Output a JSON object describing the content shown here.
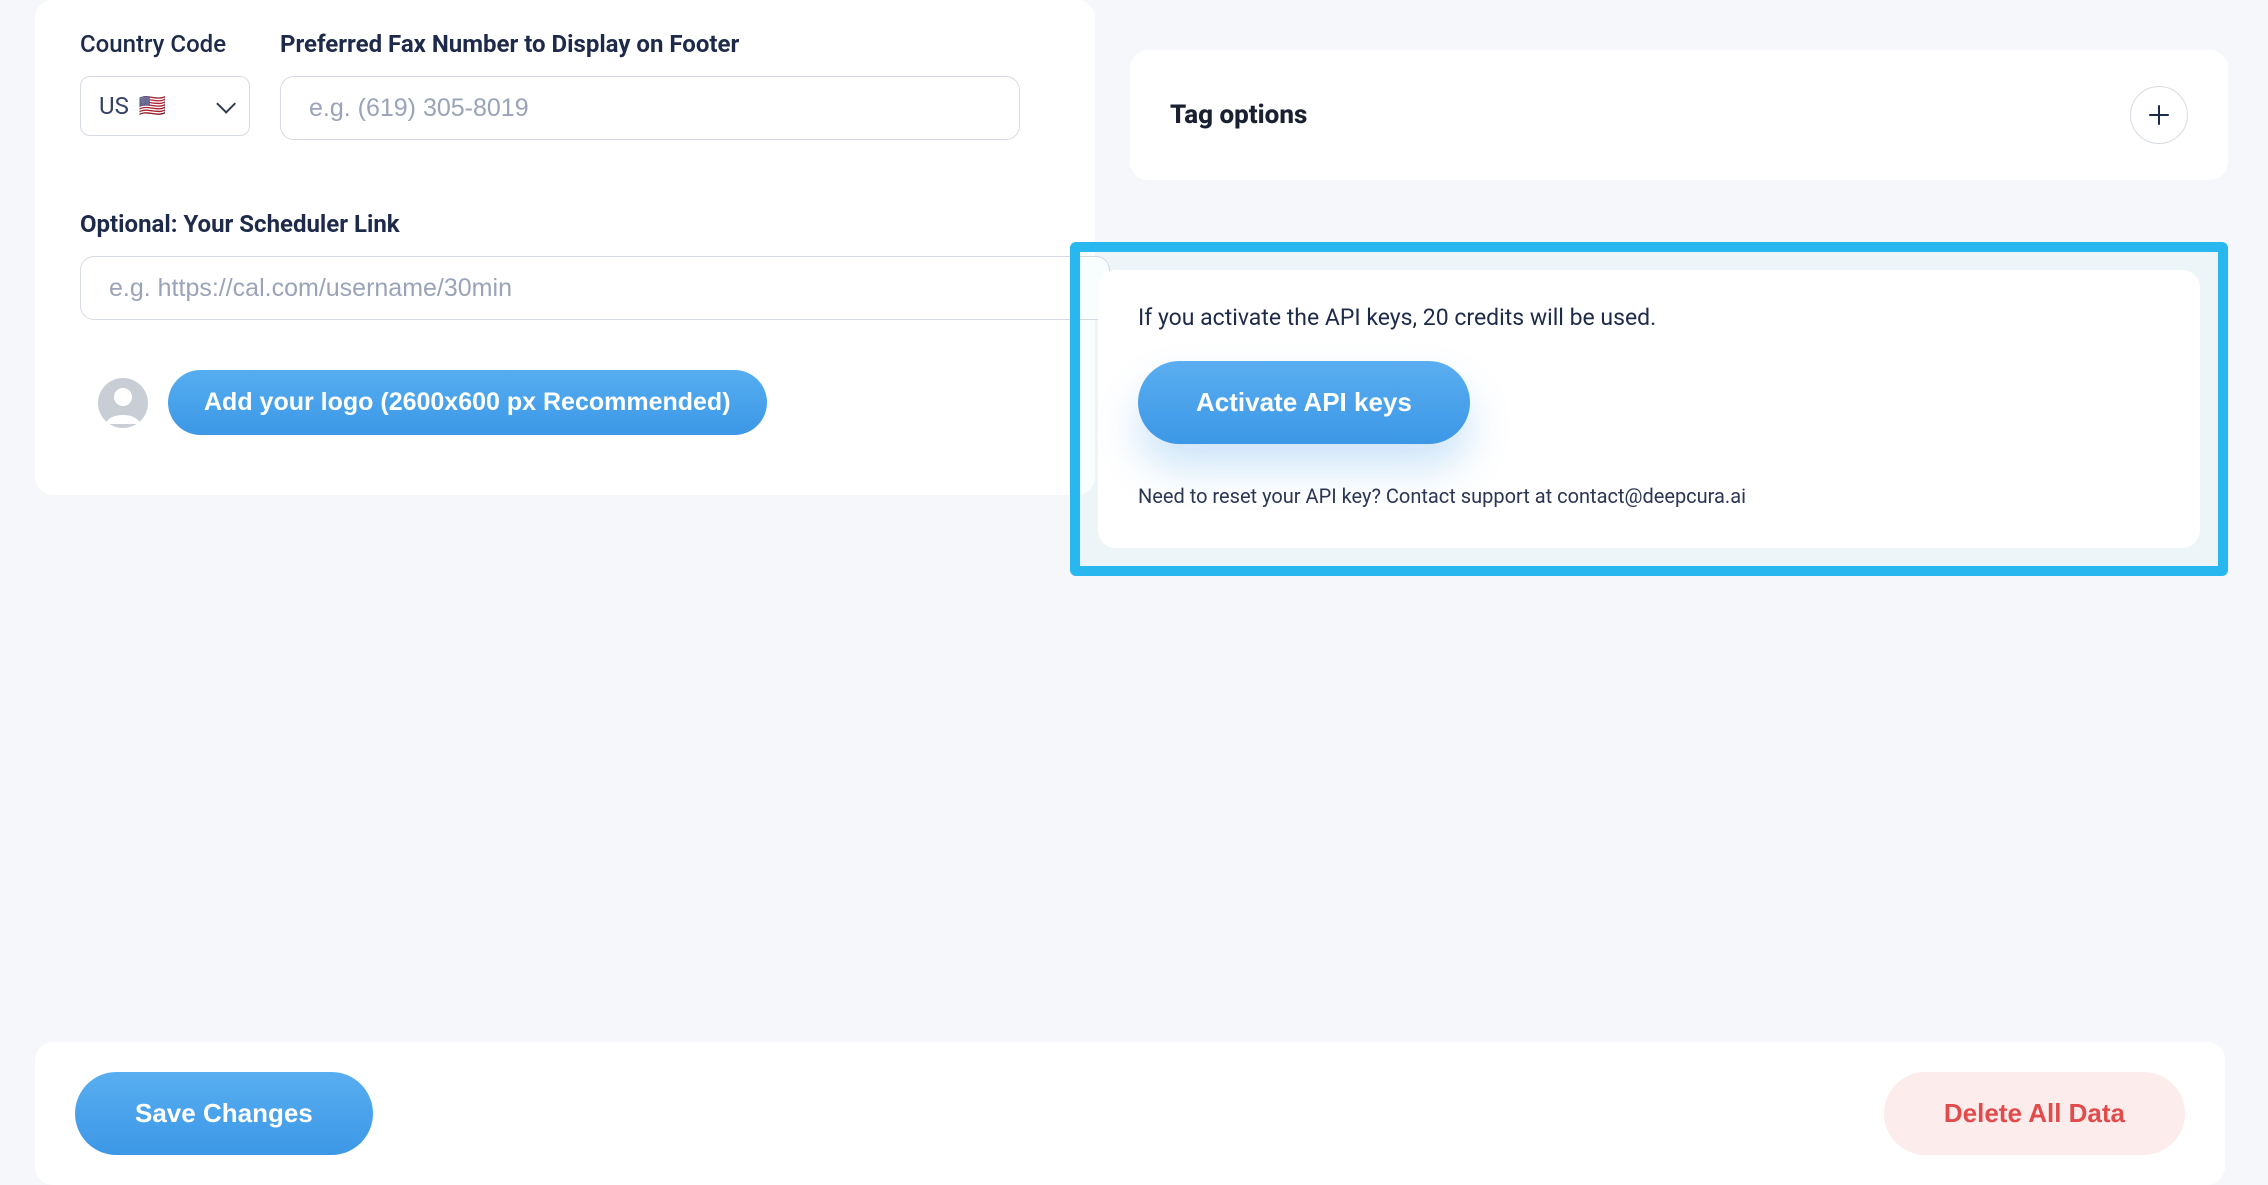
{
  "left": {
    "country_label": "Country Code",
    "country_value": "US",
    "country_flag": "🇺🇸",
    "fax_label": "Preferred Fax Number to Display on Footer",
    "fax_placeholder": "e.g. (619) 305-8019",
    "scheduler_label": "Optional: Your Scheduler Link",
    "scheduler_placeholder": "e.g. https://cal.com/username/30min",
    "add_logo_label": "Add your logo (2600x600 px Recommended)"
  },
  "right": {
    "tag_title": "Tag options",
    "api_notice": "If you activate the API keys, 20 credits will be used.",
    "activate_label": "Activate API keys",
    "api_hint": "Need to reset your API key? Contact support at contact@deepcura.ai"
  },
  "bottom": {
    "save_label": "Save Changes",
    "delete_label": "Delete All Data"
  }
}
